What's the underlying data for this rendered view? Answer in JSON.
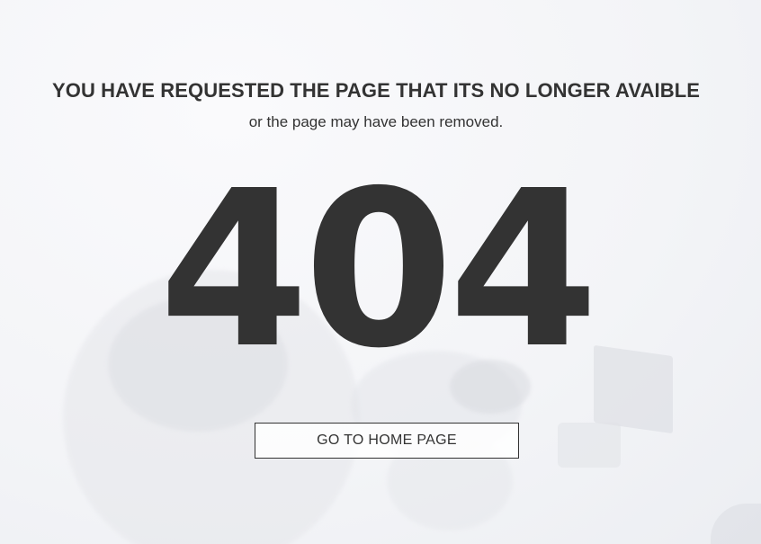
{
  "error": {
    "headline": "YOU HAVE REQUESTED THE PAGE THAT ITS NO LONGER AVAIBLE",
    "subline": "or the page may have been removed.",
    "code": "404"
  },
  "actions": {
    "home_button_label": "GO TO HOME PAGE"
  },
  "colors": {
    "text": "#333333",
    "background": "#f7f7f9"
  }
}
